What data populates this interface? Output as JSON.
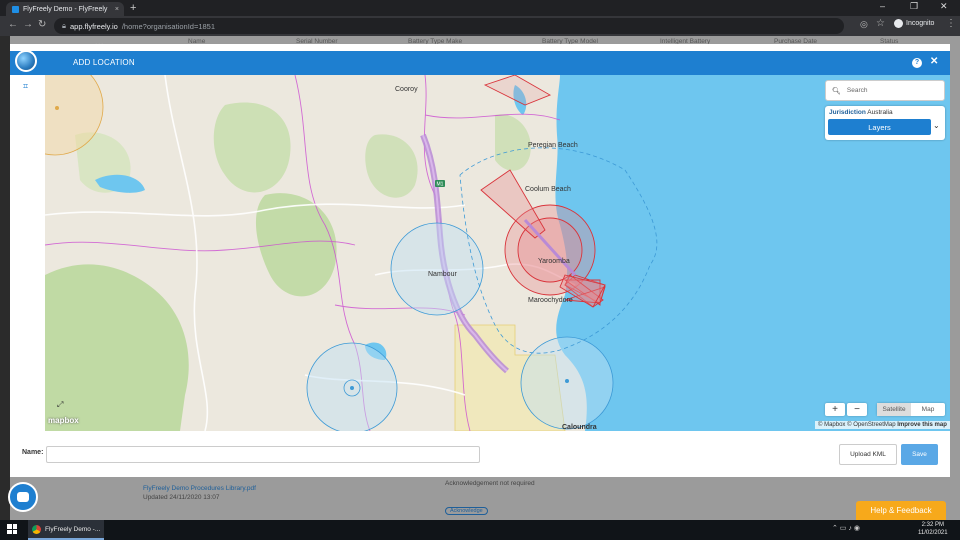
{
  "browser": {
    "tab_title": "FlyFreely Demo - FlyFreely",
    "tab_close": "×",
    "new_tab": "+",
    "url_host": "app.flyfreely.io",
    "url_path": "/home?organisationId=1851",
    "incognito_label": "Incognito",
    "window_controls": [
      "–",
      "❐",
      "✕"
    ]
  },
  "background_app": {
    "columns": [
      "Name",
      "Serial Number",
      "Battery Type Make",
      "Battery Type Model",
      "Intelligent Battery",
      "Purchase Date",
      "Status"
    ],
    "footer_rows": [
      {
        "title": "FlyFreely Demo Procedures Library.pdf",
        "updated": "Updated 24/11/2020 13:07"
      },
      {
        "status": "Acknowledgement not required"
      },
      {
        "badge": "Acknowledge"
      }
    ]
  },
  "modal": {
    "title": "ADD LOCATION",
    "collapse_glyph": "‹‹‹",
    "help": "?",
    "close": "✕"
  },
  "map": {
    "search_placeholder": "Search",
    "jurisdiction_label": "Jurisdiction",
    "jurisdiction_value": "Australia",
    "layers_button": "Layers",
    "zoom_in": "+",
    "zoom_out": "−",
    "type_satellite": "Satellite",
    "type_map": "Map",
    "attribution": "© Mapbox © OpenStreetMap",
    "improve_link": "Improve this map",
    "mapbox_logo": "mapbox",
    "place_labels": [
      "Cooroy",
      "Peregian Beach",
      "Coolum Beach",
      "Nambour",
      "Yaroomba",
      "Maroochydore",
      "Caloundra"
    ],
    "road_label": "M1",
    "colors": {
      "water": "#6ec6ef",
      "land": "#ece8de",
      "forest": "#b9d79a",
      "controlled_airspace": "#d9343b",
      "aerodrome": "#3d9ad6",
      "highway": "#b98ad6"
    }
  },
  "form": {
    "name_label": "Name:",
    "name_value": "",
    "upload_kml": "Upload KML",
    "save": "Save"
  },
  "feedback_button": "Help & Feedback",
  "taskbar": {
    "app_label": "FlyFreely Demo -...",
    "time": "2:32 PM",
    "date": "11/02/2021"
  }
}
